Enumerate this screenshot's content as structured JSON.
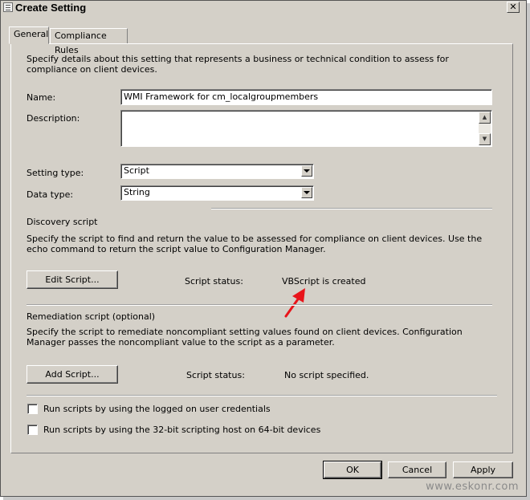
{
  "window": {
    "title": "Create Setting",
    "close_glyph": "✕"
  },
  "tabs": [
    {
      "label": "General",
      "active": true
    },
    {
      "label": "Compliance Rules",
      "active": false
    }
  ],
  "general": {
    "intro": "Specify details about this setting that represents a business or technical condition to assess for compliance on client devices.",
    "name_label": "Name:",
    "name_value": "WMI Framework for cm_localgroupmembers",
    "description_label": "Description:",
    "description_value": "",
    "setting_type_label": "Setting type:",
    "setting_type_value": "Script",
    "data_type_label": "Data type:",
    "data_type_value": "String"
  },
  "discovery": {
    "heading": "Discovery script",
    "text": "Specify the script to find and return the value to be assessed for compliance on client devices. Use the echo command to return the script value to Configuration Manager.",
    "button": "Edit Script...",
    "status_label": "Script status:",
    "status_value": "VBScript is created"
  },
  "remediation": {
    "heading": "Remediation script (optional)",
    "text": "Specify the script to remediate noncompliant setting values found on client devices. Configuration Manager passes the noncompliant value to the script as a parameter.",
    "button": "Add Script...",
    "status_label": "Script status:",
    "status_value": "No script specified."
  },
  "options": [
    {
      "label": "Run scripts by using the logged on user credentials",
      "checked": false
    },
    {
      "label": "Run scripts by using the 32-bit scripting host on 64-bit devices",
      "checked": false
    }
  ],
  "footer": {
    "ok": "OK",
    "cancel": "Cancel",
    "apply": "Apply"
  },
  "watermark": "www.eskonr.com",
  "annotation": {
    "arrow_color": "#e8141a"
  }
}
